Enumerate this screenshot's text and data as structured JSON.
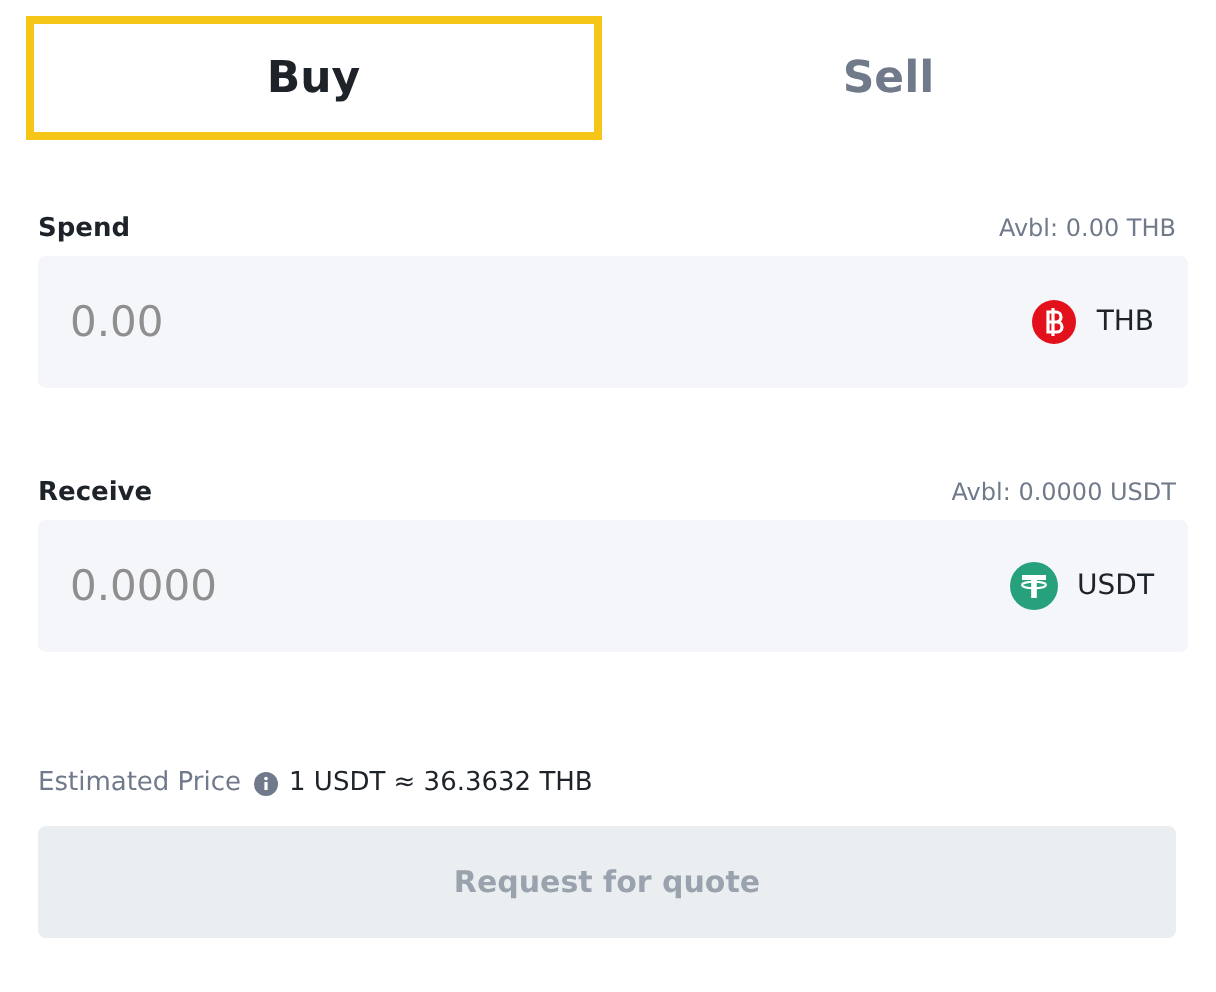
{
  "tabs": [
    {
      "label": "Buy",
      "selected": true
    },
    {
      "label": "Sell",
      "selected": false
    }
  ],
  "fields": [
    {
      "label": "Spend",
      "available": "Avbl: 0.00 THB",
      "placeholder": "0.00",
      "currency": "THB",
      "kind": "baht"
    },
    {
      "label": "Receive",
      "available": "Avbl: 0.0000 USDT",
      "placeholder": "0.0000",
      "currency": "USDT",
      "kind": "tether"
    }
  ],
  "estimate": {
    "label": "Estimated Price",
    "value": "1 USDT ≈ 36.3632 THB"
  },
  "submit": {
    "label": "Request for quote",
    "disabled": true
  }
}
